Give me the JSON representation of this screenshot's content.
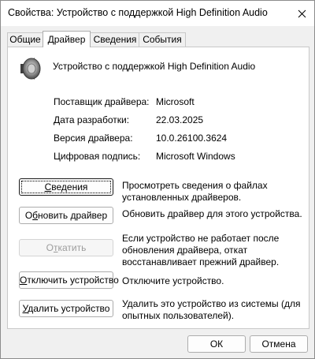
{
  "window": {
    "title": "Свойства: Устройство с поддержкой High Definition Audio"
  },
  "tabs": [
    {
      "label": "Общие",
      "active": false
    },
    {
      "label": "Драйвер",
      "active": true
    },
    {
      "label": "Сведения",
      "active": false
    },
    {
      "label": "События",
      "active": false
    }
  ],
  "device": {
    "name": "Устройство с поддержкой High Definition Audio",
    "icon": "speaker-icon"
  },
  "properties": [
    {
      "label": "Поставщик драйвера:",
      "value": "Microsoft"
    },
    {
      "label": "Дата разработки:",
      "value": "22.03.2025"
    },
    {
      "label": "Версия драйвера:",
      "value": "10.0.26100.3624"
    },
    {
      "label": "Цифровая подпись:",
      "value": "Microsoft Windows"
    }
  ],
  "actions": [
    {
      "pre": "",
      "key": "С",
      "post": "ведения",
      "description": "Просмотреть сведения о файлах установленных драйверов.",
      "enabled": true,
      "focused": true
    },
    {
      "pre": "О",
      "key": "б",
      "post": "новить драйвер",
      "description": "Обновить драйвер для этого устройства.",
      "enabled": true,
      "focused": false
    },
    {
      "pre": "О",
      "key": "т",
      "post": "катить",
      "description": "Если устройство не работает после обновления драйвера, откат восстанавливает прежний драйвер.",
      "enabled": false,
      "focused": false
    },
    {
      "pre": "",
      "key": "О",
      "post": "тключить устройство",
      "description": "Отключите устройство.",
      "enabled": true,
      "focused": false
    },
    {
      "pre": "",
      "key": "У",
      "post": "далить устройство",
      "description": "Удалить это устройство из системы (для опытных пользователей).",
      "enabled": true,
      "focused": false
    }
  ],
  "footer": {
    "ok_label": "ОК",
    "cancel_label": "Отмена"
  }
}
